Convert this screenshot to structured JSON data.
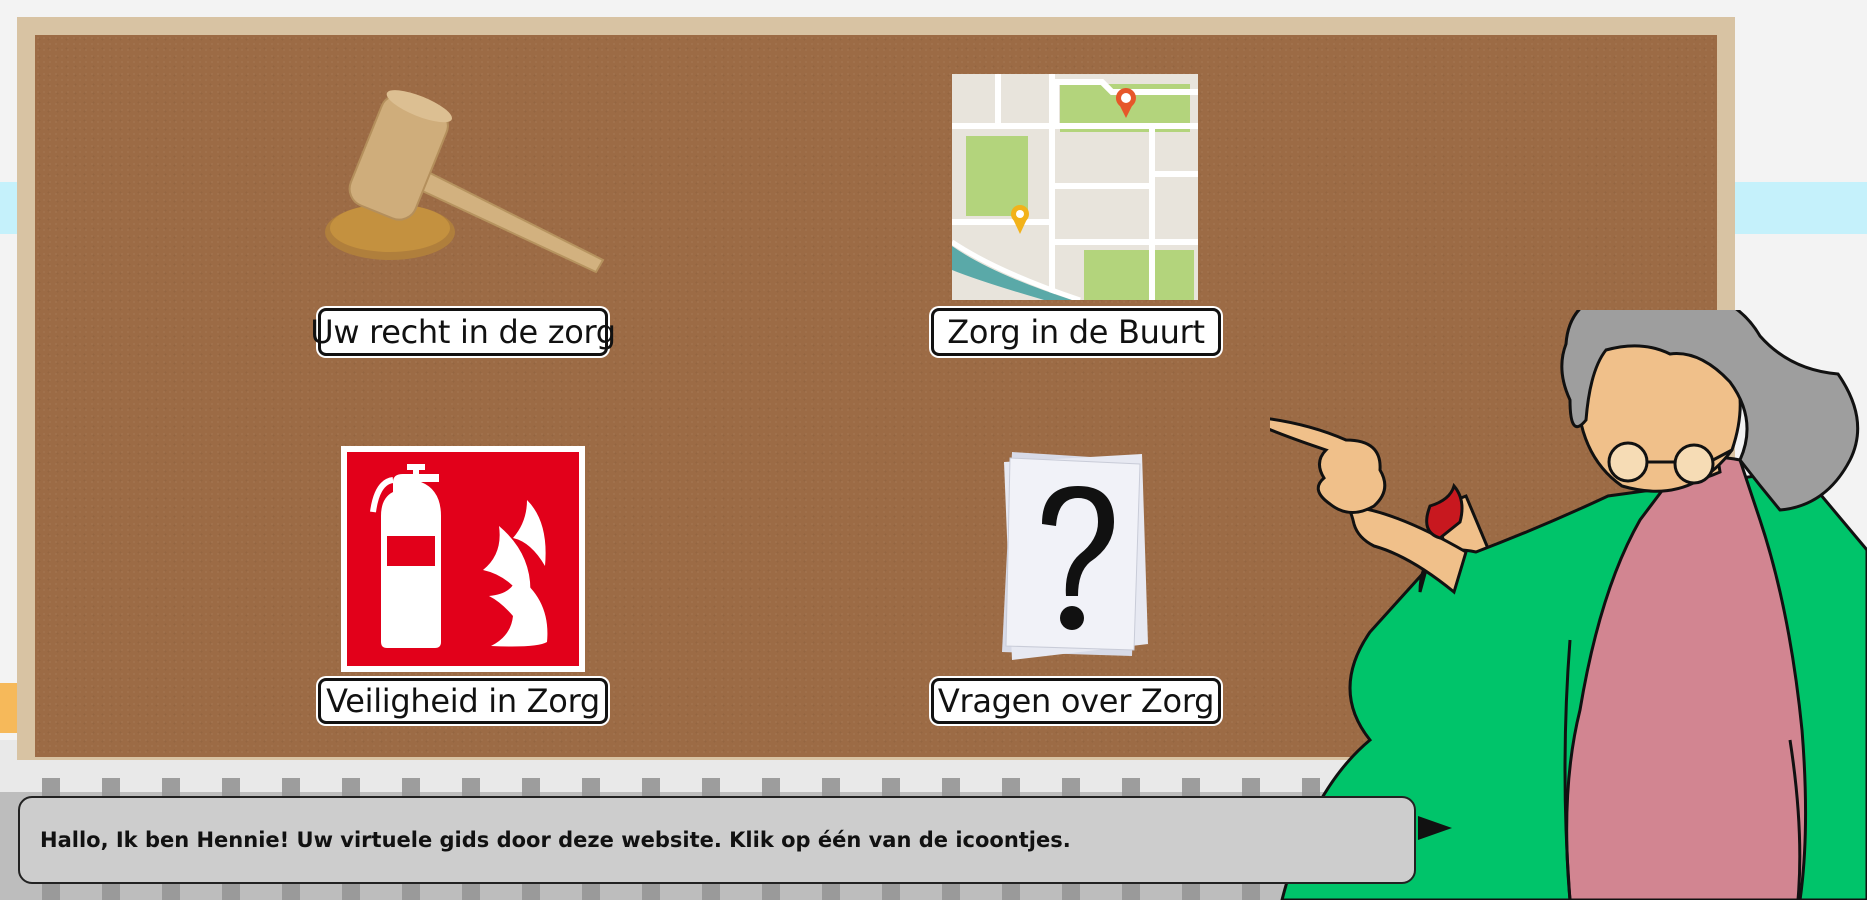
{
  "board": {
    "tiles": [
      {
        "label": "Uw recht in de zorg",
        "icon": "gavel-icon"
      },
      {
        "label": "Zorg in de Buurt",
        "icon": "map-icon"
      },
      {
        "label": "Veiligheid in Zorg",
        "icon": "fire-extinguisher-icon"
      },
      {
        "label": "Vragen over Zorg",
        "icon": "question-mark-icon"
      }
    ]
  },
  "guide": {
    "speech": "Hallo, Ik ben Hennie! Uw virtuele gids door deze website. Klik op één van de icoontjes."
  },
  "colors": {
    "board": "#9c6b45",
    "frame": "#d8c3a3",
    "fire_red": "#e2001a",
    "map_green": "#b3d47c",
    "cardigan_green": "#00c46a",
    "shirt_pink": "#d28591"
  }
}
